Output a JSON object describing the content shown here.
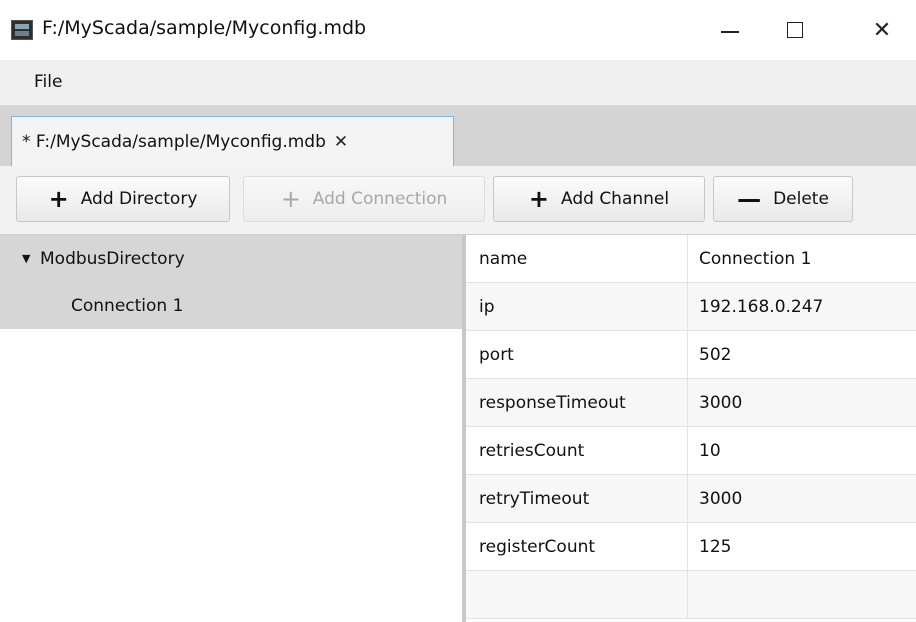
{
  "window": {
    "title": "F:/MyScada/sample/Myconfig.mdb",
    "app_icon": "scada-app-icon",
    "controls": {
      "minimize": "—",
      "maximize": "☐",
      "close": "✕"
    }
  },
  "menu": {
    "items": [
      {
        "label": "File"
      }
    ]
  },
  "tabs": [
    {
      "label": "* F:/MyScada/sample/Myconfig.mdb",
      "close": "✕",
      "active": true
    }
  ],
  "toolbar": {
    "buttons": [
      {
        "glyph": "+",
        "label": "Add Directory",
        "enabled": true
      },
      {
        "glyph": "+",
        "label": "Add Connection",
        "enabled": false
      },
      {
        "glyph": "+",
        "label": "Add Channel",
        "enabled": true
      },
      {
        "glyph": "—",
        "label": "Delete",
        "enabled": true
      }
    ]
  },
  "tree": {
    "root": {
      "label": "ModbusDirectory",
      "expanded": true,
      "arrow": "▼"
    },
    "children": [
      {
        "label": "Connection 1",
        "selected": true
      }
    ]
  },
  "properties": [
    {
      "key": "name",
      "value": "Connection 1"
    },
    {
      "key": "ip",
      "value": "192.168.0.247"
    },
    {
      "key": "port",
      "value": "502"
    },
    {
      "key": "responseTimeout",
      "value": "3000"
    },
    {
      "key": "retriesCount",
      "value": "10"
    },
    {
      "key": "retryTimeout",
      "value": "3000"
    },
    {
      "key": "registerCount",
      "value": "125"
    },
    {
      "key": "",
      "value": ""
    }
  ],
  "colors": {
    "tab_border": "#7ab6e6",
    "selection": "#d6d6d6"
  }
}
